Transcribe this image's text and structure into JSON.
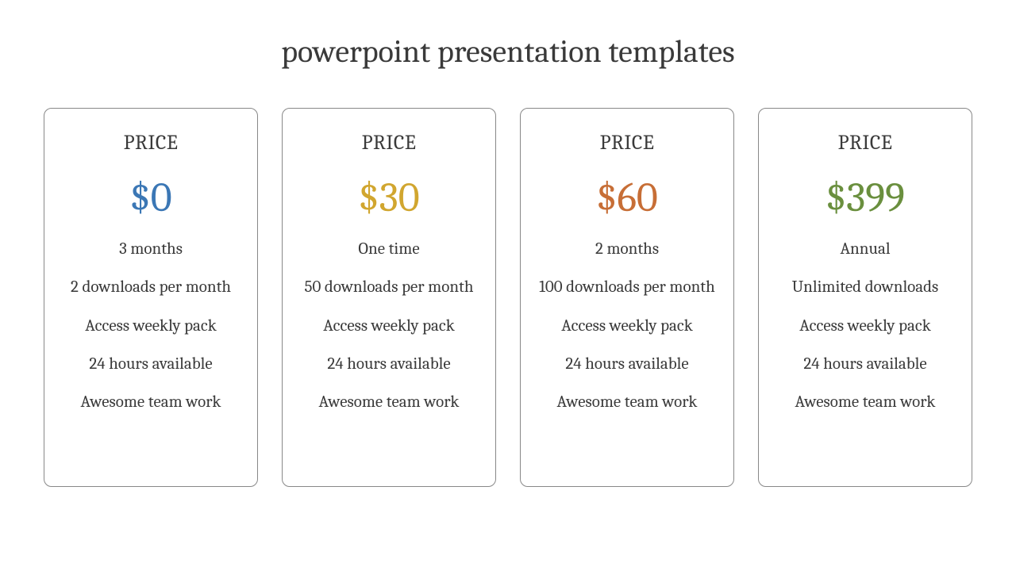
{
  "title": "powerpoint presentation templates",
  "cards": [
    {
      "label": "PRICE",
      "price": "$0",
      "priceColor": "#3b77b5",
      "features": [
        "3 months",
        "2 downloads per month",
        "Access weekly pack",
        "24 hours available",
        "Awesome team work"
      ]
    },
    {
      "label": "PRICE",
      "price": "$30",
      "priceColor": "#d1a62f",
      "features": [
        "One time",
        "50 downloads per month",
        "Access weekly pack",
        "24 hours available",
        "Awesome team work"
      ]
    },
    {
      "label": "PRICE",
      "price": "$60",
      "priceColor": "#c76e36",
      "features": [
        "2 months",
        "100 downloads per month",
        "Access weekly pack",
        "24 hours available",
        "Awesome team work"
      ]
    },
    {
      "label": "PRICE",
      "price": "$399",
      "priceColor": "#6a8f3e",
      "features": [
        "Annual",
        "Unlimited downloads",
        "Access weekly pack",
        "24 hours available",
        "Awesome team work"
      ]
    }
  ]
}
